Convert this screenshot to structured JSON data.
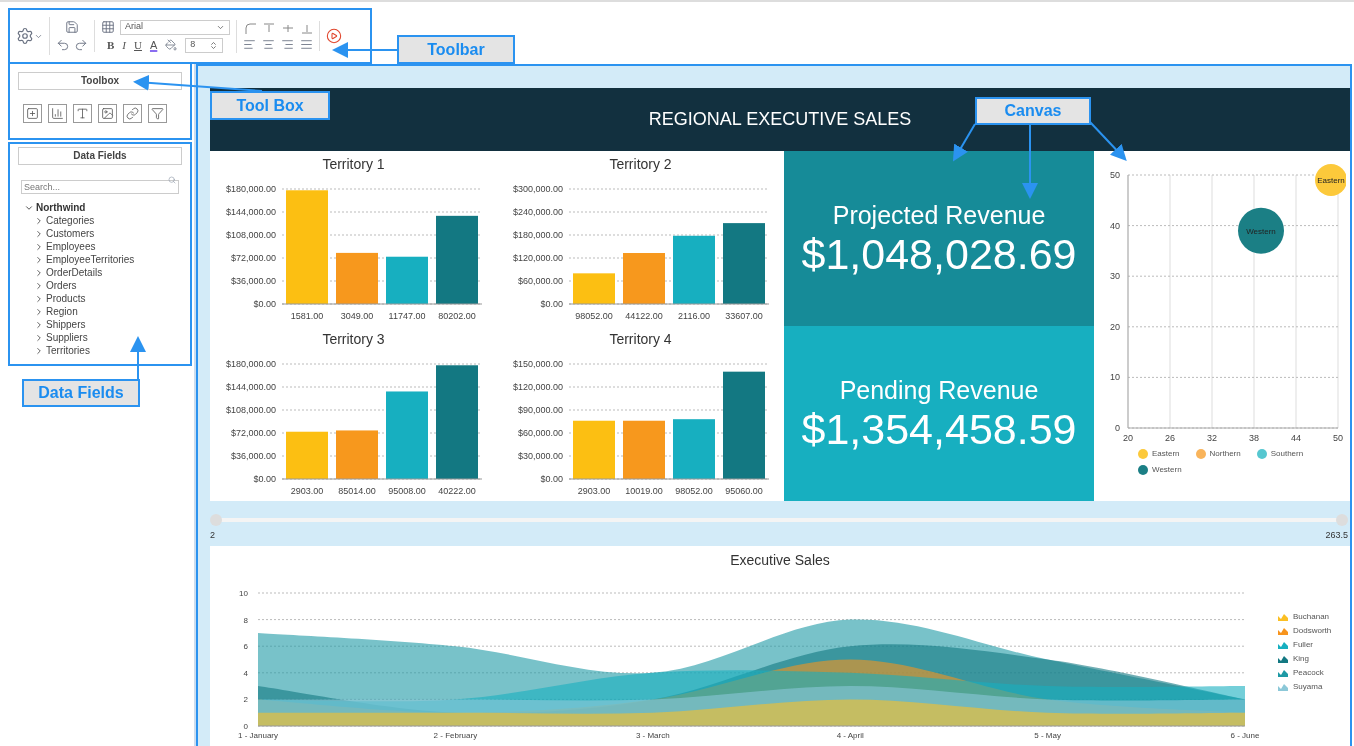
{
  "toolbar": {
    "font": "Arial",
    "font_size": "8",
    "format_buttons": [
      "B",
      "I",
      "U",
      "A"
    ]
  },
  "callouts": [
    {
      "label": "Toolbar"
    },
    {
      "label": "Tool Box"
    },
    {
      "label": "Data Fields"
    },
    {
      "label": "Canvas"
    }
  ],
  "toolbox": {
    "title": "Toolbox"
  },
  "data_fields": {
    "title": "Data Fields",
    "search": {
      "placeholder": "Search..."
    },
    "tree": [
      {
        "label": "Northwind",
        "expanded": true,
        "children": [
          {
            "label": "Categories",
            "expanded": false
          },
          {
            "label": "Customers",
            "expanded": false
          },
          {
            "label": "Employees",
            "expanded": false
          },
          {
            "label": "EmployeeTerritories",
            "expanded": false
          },
          {
            "label": "OrderDetails",
            "expanded": false
          },
          {
            "label": "Orders",
            "expanded": false
          },
          {
            "label": "Products",
            "expanded": false
          },
          {
            "label": "Region",
            "expanded": false
          },
          {
            "label": "Shippers",
            "expanded": false
          },
          {
            "label": "Suppliers",
            "expanded": false
          },
          {
            "label": "Territories",
            "expanded": false
          }
        ]
      }
    ]
  },
  "dashboard": {
    "title": "REGIONAL EXECUTIVE SALES",
    "territories": [
      {
        "chart_data": {
          "type": "bar",
          "title": "Territory 1",
          "grid": true,
          "categories": [
            "1581.00",
            "3049.00",
            "11747.00",
            "80202.00"
          ],
          "values": [
            178000,
            80000,
            74000,
            138000
          ],
          "ylim": [
            0,
            180000
          ],
          "yticks": [
            {
              "value": 0,
              "label": "$0.00"
            },
            {
              "value": 36000,
              "label": "$36,000.00"
            },
            {
              "value": 72000,
              "label": "$72,000.00"
            },
            {
              "value": 108000,
              "label": "$108,000.00"
            },
            {
              "value": 144000,
              "label": "$144,000.00"
            },
            {
              "value": 180000,
              "label": "$180,000.00"
            }
          ]
        }
      },
      {
        "chart_data": {
          "type": "bar",
          "title": "Territory 2",
          "grid": true,
          "categories": [
            "98052.00",
            "44122.00",
            "2116.00",
            "33607.00"
          ],
          "values": [
            80000,
            133000,
            178000,
            211000
          ],
          "ylim": [
            0,
            300000
          ],
          "yticks": [
            {
              "value": 0,
              "label": "$0.00"
            },
            {
              "value": 60000,
              "label": "$60,000.00"
            },
            {
              "value": 120000,
              "label": "$120,000.00"
            },
            {
              "value": 180000,
              "label": "$180,000.00"
            },
            {
              "value": 240000,
              "label": "$240,000.00"
            },
            {
              "value": 300000,
              "label": "$300,000.00"
            }
          ]
        }
      },
      {
        "chart_data": {
          "type": "bar",
          "title": "Territory 3",
          "grid": true,
          "categories": [
            "2903.00",
            "85014.00",
            "95008.00",
            "40222.00"
          ],
          "values": [
            74000,
            76000,
            137000,
            178000
          ],
          "ylim": [
            0,
            180000
          ],
          "yticks": [
            {
              "value": 0,
              "label": "$0.00"
            },
            {
              "value": 36000,
              "label": "$36,000.00"
            },
            {
              "value": 72000,
              "label": "$72,000.00"
            },
            {
              "value": 108000,
              "label": "$108,000.00"
            },
            {
              "value": 144000,
              "label": "$144,000.00"
            },
            {
              "value": 180000,
              "label": "$180,000.00"
            }
          ]
        }
      },
      {
        "chart_data": {
          "type": "bar",
          "title": "Territory 4",
          "grid": true,
          "categories": [
            "2903.00",
            "10019.00",
            "98052.00",
            "95060.00"
          ],
          "values": [
            76000,
            76000,
            78000,
            140000
          ],
          "ylim": [
            0,
            150000
          ],
          "yticks": [
            {
              "value": 0,
              "label": "$0.00"
            },
            {
              "value": 30000,
              "label": "$30,000.00"
            },
            {
              "value": 60000,
              "label": "$60,000.00"
            },
            {
              "value": 90000,
              "label": "$90,000.00"
            },
            {
              "value": 120000,
              "label": "$120,000.00"
            },
            {
              "value": 150000,
              "label": "$150,000.00"
            }
          ]
        }
      }
    ],
    "revenue": [
      {
        "label": "Projected Revenue",
        "value": "$1,048,028.69"
      },
      {
        "label": "Pending Revenue",
        "value": "$1,354,458.59"
      }
    ],
    "bubble": {
      "bubble_labels": [
        "Eastern",
        "Western"
      ],
      "chart_data": {
        "type": "scatter",
        "grid": true,
        "x": [
          39,
          49
        ],
        "xlim": [
          20,
          50
        ],
        "ylim": [
          0,
          50
        ],
        "xticks": [
          20,
          26,
          32,
          38,
          44,
          50
        ],
        "yticks": [
          0,
          10,
          20,
          30,
          40,
          50
        ],
        "series": [
          {
            "name": "Eastern",
            "color": "#fcc93b",
            "values": [
              null,
              49
            ]
          },
          {
            "name": "Northern",
            "color": "#f9b45b",
            "values": [
              null,
              null
            ]
          },
          {
            "name": "Southern",
            "color": "#56c7d0",
            "values": [
              null,
              null
            ]
          },
          {
            "name": "Western",
            "color": "#1b7f85",
            "values": [
              39,
              null
            ]
          }
        ]
      }
    },
    "slider": {
      "min_label": "2",
      "max_label": "263.5",
      "level": 1
    },
    "executive": {
      "chart_data": {
        "type": "area",
        "title": "Executive Sales",
        "grid": true,
        "categories": [
          "1 - January",
          "2 - February",
          "3 - March",
          "4 - April",
          "5 - May",
          "6 - June"
        ],
        "ylim": [
          0,
          10
        ],
        "yticks": [
          0,
          2,
          4,
          6,
          8,
          10
        ],
        "series": [
          {
            "name": "Buchanan",
            "color": "#fbbf24",
            "values": [
              1,
              1,
              1,
              2,
              1,
              1
            ]
          },
          {
            "name": "Dodsworth",
            "color": "#f7941d",
            "values": [
              2,
              1,
              2,
              5,
              2,
              1
            ]
          },
          {
            "name": "Fuller",
            "color": "#17afc0",
            "values": [
              2,
              2,
              4,
              4,
              3,
              3
            ]
          },
          {
            "name": "King",
            "color": "#137882",
            "values": [
              3,
              1,
              2,
              6,
              5,
              2
            ]
          },
          {
            "name": "Peacock",
            "color": "#1e9aa5",
            "values": [
              7,
              6,
              4,
              8,
              5,
              2
            ]
          },
          {
            "name": "Suyama",
            "color": "#8cc8d8",
            "values": [
              2,
              2,
              2,
              3,
              2,
              2
            ]
          }
        ]
      }
    }
  }
}
